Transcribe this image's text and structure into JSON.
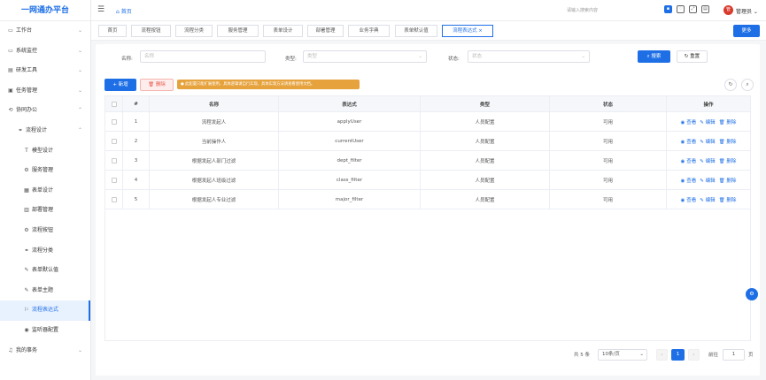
{
  "app_title": "一网通办平台",
  "sidebar": {
    "items": [
      {
        "label": "工作台",
        "icon": "monitor-icon",
        "glyph": "▭",
        "chev": "⌄"
      },
      {
        "label": "系统监控",
        "icon": "monitor-icon",
        "glyph": "▭",
        "chev": "⌄"
      },
      {
        "label": "研发工具",
        "icon": "tool-icon",
        "glyph": "▤",
        "chev": "⌄"
      },
      {
        "label": "任务管理",
        "icon": "task-icon",
        "glyph": "▣",
        "chev": "⌄"
      },
      {
        "label": "协同办公",
        "icon": "cooperation-icon",
        "glyph": "⟲",
        "chev": "⌃"
      },
      {
        "label": "流程设计",
        "icon": "flow-icon",
        "glyph": "⚭",
        "chev": "⌃"
      },
      {
        "label": "模型设计",
        "icon": "model-icon",
        "glyph": "T"
      },
      {
        "label": "服务管理",
        "icon": "gear-icon",
        "glyph": "⚙"
      },
      {
        "label": "表单设计",
        "icon": "form-icon",
        "glyph": "▦"
      },
      {
        "label": "部署管理",
        "icon": "chart-icon",
        "glyph": "▥"
      },
      {
        "label": "流程按钮",
        "icon": "gear-icon",
        "glyph": "⚙"
      },
      {
        "label": "流程分类",
        "icon": "category-icon",
        "glyph": "⚭"
      },
      {
        "label": "表单默认值",
        "icon": "edit-icon",
        "glyph": "✎"
      },
      {
        "label": "表单主题",
        "icon": "brush-icon",
        "glyph": "✎"
      },
      {
        "label": "流程表达式",
        "icon": "flag-icon",
        "glyph": "⚐"
      },
      {
        "label": "监听器配置",
        "icon": "listener-icon",
        "glyph": "◉"
      },
      {
        "label": "我的事务",
        "icon": "bell-icon",
        "glyph": "♫",
        "chev": "⌄"
      }
    ]
  },
  "topbar": {
    "home_label": "首页",
    "search_placeholder": "请输入搜索内容",
    "user_name": "管理员",
    "avatar_text": "管"
  },
  "tabs": [
    {
      "label": "首页"
    },
    {
      "label": "流程按钮"
    },
    {
      "label": "流程分类"
    },
    {
      "label": "服务管理"
    },
    {
      "label": "表单设计"
    },
    {
      "label": "部署管理"
    },
    {
      "label": "业务字典"
    },
    {
      "label": "表单默认值"
    },
    {
      "label": "流程表达式 ×"
    }
  ],
  "more_label": "更多",
  "filters": {
    "name_label": "名称:",
    "name_placeholder": "名称",
    "type_label": "类型:",
    "type_placeholder": "类型",
    "status_label": "状态:",
    "status_placeholder": "状态",
    "search_label": "⌕ 搜索",
    "reset_label": "↻ 重置"
  },
  "toolbar": {
    "add_label": "+ 新增",
    "delete_label": "🗑 删除",
    "tip": "● 此配置只能扩展使用，具体逻辑请自行实现，具体实现方法请查看使用文档。"
  },
  "table": {
    "headers": [
      "#",
      "名称",
      "表达式",
      "类型",
      "状态",
      "操作"
    ],
    "rows": [
      {
        "index": "1",
        "name": "流程发起人",
        "expr": "applyUser",
        "type": "人员配置",
        "status": "可用"
      },
      {
        "index": "2",
        "name": "当前操作人",
        "expr": "currentUser",
        "type": "人员配置",
        "status": "可用"
      },
      {
        "index": "3",
        "name": "根据发起人部门过滤",
        "expr": "dept_filter",
        "type": "人员配置",
        "status": "可用"
      },
      {
        "index": "4",
        "name": "根据发起人班级过滤",
        "expr": "class_filter",
        "type": "人员配置",
        "status": "可用"
      },
      {
        "index": "5",
        "name": "根据发起人专业过滤",
        "expr": "major_filter",
        "type": "人员配置",
        "status": "可用"
      }
    ],
    "actions": {
      "view": "◉ 查看",
      "edit": "✎ 编辑",
      "delete": "🗑 删除"
    }
  },
  "pagination": {
    "total": "共 5 条",
    "page_size": "10条/页",
    "current": "1",
    "goto_label": "前往",
    "goto_value": "1",
    "page_unit": "页"
  }
}
